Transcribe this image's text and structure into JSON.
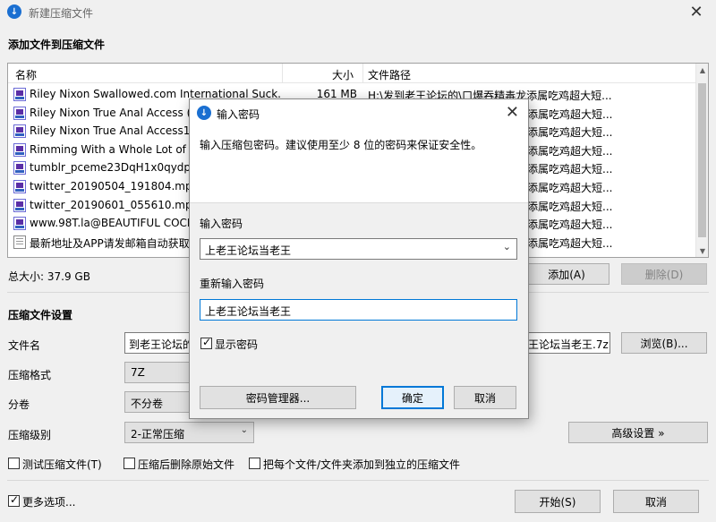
{
  "window": {
    "title": "新建压缩文件",
    "close_glyph": "✕"
  },
  "add_section": {
    "title": "添加文件到压缩文件"
  },
  "file_list": {
    "headers": {
      "name": "名称",
      "size": "大小",
      "path": "文件路径"
    },
    "rows": [
      {
        "name": "Riley Nixon Swallowed.com International Suck...",
        "size": "161 MB",
        "path": "H:\\发到老王论坛的\\口爆吞精毒龙添属吃鸡超大短...",
        "icon": "video-file-icon"
      },
      {
        "name": "Riley Nixon True Anal Access (2",
        "size": "",
        "path": "添属吃鸡超大短...",
        "icon": "video-file-icon"
      },
      {
        "name": "Riley Nixon True Anal Access1 (",
        "size": "",
        "path": "添属吃鸡超大短...",
        "icon": "video-file-icon"
      },
      {
        "name": "Rimming With a Whole Lot of B",
        "size": "",
        "path": "添属吃鸡超大短...",
        "icon": "video-file-icon"
      },
      {
        "name": "tumblr_pceme23DqH1x0qydp.m",
        "size": "",
        "path": "添属吃鸡超大短...",
        "icon": "video-file-icon"
      },
      {
        "name": "twitter_20190504_191804.mp4",
        "size": "",
        "path": "添属吃鸡超大短...",
        "icon": "video-file-icon"
      },
      {
        "name": "twitter_20190601_055610.mp4",
        "size": "",
        "path": "添属吃鸡超大短...",
        "icon": "video-file-icon"
      },
      {
        "name": "www.98T.la@BEAUTIFUL COCKS",
        "size": "",
        "path": "添属吃鸡超大短...",
        "icon": "video-file-icon"
      },
      {
        "name": "最新地址及APP请发邮箱自动获取!",
        "size": "",
        "path": "添属吃鸡超大短...",
        "icon": "text-file-icon"
      }
    ]
  },
  "total_size": "总大小: 37.9 GB",
  "buttons": {
    "add": "添加(A)",
    "delete": "删除(D)",
    "browse": "浏览(B)...",
    "advanced": "高级设置 »",
    "start": "开始(S)",
    "cancel": "取消"
  },
  "settings": {
    "title": "压缩文件设置",
    "filename_label": "文件名",
    "filename_value_left": "到老王论坛的",
    "filename_value_right": "王论坛当老王.7z",
    "format_label": "压缩格式",
    "format_value": "7Z",
    "volume_label": "分卷",
    "volume_value": "不分卷",
    "level_label": "压缩级别",
    "level_value": "2-正常压缩"
  },
  "options": {
    "test": "测试压缩文件(T)",
    "delete_after": "压缩后删除原始文件",
    "separate": "把每个文件/文件夹添加到独立的压缩文件",
    "more": "更多选项..."
  },
  "dialog": {
    "title": "输入密码",
    "description": "输入压缩包密码。建议使用至少 8 位的密码来保证安全性。",
    "password_label": "输入密码",
    "password_value": "上老王论坛当老王",
    "confirm_label": "重新输入密码",
    "confirm_value": "上老王论坛当老王",
    "show_password": "显示密码",
    "manager_button": "密码管理器...",
    "ok_button": "确定",
    "cancel_button": "取消"
  }
}
